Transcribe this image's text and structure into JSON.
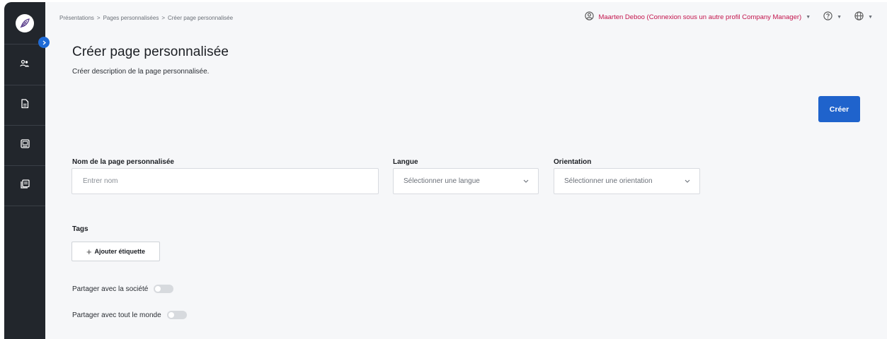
{
  "sidebar": {
    "items": [
      {
        "icon": "users-icon",
        "label": ""
      },
      {
        "icon": "document-icon",
        "label": ""
      },
      {
        "icon": "image-icon",
        "label": ""
      },
      {
        "icon": "pages-icon",
        "label": ""
      }
    ]
  },
  "breadcrumb": {
    "items": [
      "Présentations",
      "Pages personnalisées",
      "Créer page personnalisée"
    ],
    "separator": ">"
  },
  "header": {
    "user_label": "Maarten Deboo (Connexion sous un autre profil Company Manager)",
    "user_color": "#c3144c"
  },
  "page": {
    "title": "Créer page personnalisée",
    "description": "Créer description de la page personnalisée.",
    "create_label": "Créer"
  },
  "form": {
    "name_label": "Nom de la page personnalisée",
    "name_placeholder": "Entrer nom",
    "language_label": "Langue",
    "language_placeholder": "Sélectionner une langue",
    "orientation_label": "Orientation",
    "orientation_placeholder": "Sélectionner une orientation",
    "tags_label": "Tags",
    "add_tag_label": "Ajouter étiquette",
    "share_company_label": "Partager avec la société",
    "share_everyone_label": "Partager avec tout le monde",
    "share_company_on": false,
    "share_everyone_on": false
  },
  "colors": {
    "accent": "#1f63cc",
    "sidebar_bg": "#22262c",
    "page_bg": "#f6f7f9"
  }
}
